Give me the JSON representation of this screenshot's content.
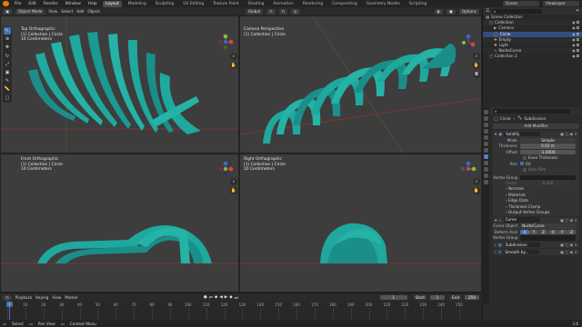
{
  "topbar": {
    "menus": [
      "File",
      "Edit",
      "Render",
      "Window",
      "Help"
    ],
    "tabs": [
      "Layout",
      "Modeling",
      "Sculpting",
      "UV Editing",
      "Texture Paint",
      "Shading",
      "Animation",
      "Rendering",
      "Compositing",
      "Geometry Nodes",
      "Scripting"
    ],
    "active_tab": "Layout",
    "scene": "Scene",
    "view_layer": "ViewLayer"
  },
  "viewport_header": {
    "mode": "Object Mode",
    "menus": [
      "View",
      "Select",
      "Add",
      "Object"
    ],
    "orientation": "Global",
    "options": "Options"
  },
  "viewports": [
    {
      "view": "Top Orthographic",
      "collection": "(1) Collection | Circle",
      "scale": "10 Centimeters"
    },
    {
      "view": "Camera Perspective",
      "collection": "(1) Collection | Circle",
      "scale": ""
    },
    {
      "view": "Front Orthographic",
      "collection": "(1) Collection | Circle",
      "scale": "10 Centimeters"
    },
    {
      "view": "Right Orthographic",
      "collection": "(1) Collection | Circle",
      "scale": "10 Centimeters"
    }
  ],
  "outliner": {
    "header": "Scene Collection",
    "items": [
      {
        "label": "Collection",
        "indent": 1
      },
      {
        "label": "Camera",
        "indent": 2
      },
      {
        "label": "Circle",
        "indent": 2,
        "selected": true
      },
      {
        "label": "Empty",
        "indent": 2
      },
      {
        "label": "Light",
        "indent": 2
      },
      {
        "label": "NurbsCurve",
        "indent": 2
      },
      {
        "label": "Collection 2",
        "indent": 1
      }
    ]
  },
  "properties": {
    "breadcrumb_obj": "Circle",
    "breadcrumb_mod": "Subdivision",
    "add_modifier": "Add Modifier",
    "solidify": {
      "name": "Solidify",
      "mode_label": "Mode",
      "mode": "Simple",
      "thickness_label": "Thickness",
      "thickness": "0.03 m",
      "offset_label": "Offset",
      "offset": "-1.0000",
      "even_thickness": "Even Thickness",
      "rim_label": "Rim",
      "fill": "Fill",
      "only_rim": "Only Rim",
      "vertex_group_label": "Vertex Group",
      "factor_label": "Factor",
      "factor": "0.000",
      "subpanels": [
        "Normals",
        "Materials",
        "Edge Data",
        "Thickness Clamp",
        "Output Vertex Groups"
      ]
    },
    "curve": {
      "name": "Curve",
      "curve_object_label": "Curve Object",
      "curve_object": "NurbsCurve",
      "deform_axis_label": "Deform Axis",
      "axes": [
        "X",
        "Y",
        "Z",
        "-X",
        "-Y",
        "-Z"
      ],
      "vertex_group_label": "Vertex Group"
    },
    "subdivision": {
      "name": "Subdivision"
    },
    "smooth": {
      "name": "Smooth by..."
    }
  },
  "timeline": {
    "menus": [
      "Playback",
      "Keying",
      "View",
      "Marker"
    ],
    "current_frame": "1",
    "start_label": "Start",
    "start": "1",
    "end_label": "End",
    "end": "250",
    "ticks": [
      "0",
      "10",
      "20",
      "30",
      "40",
      "50",
      "60",
      "70",
      "80",
      "90",
      "100",
      "110",
      "120",
      "130",
      "140",
      "150",
      "160",
      "170",
      "180",
      "190",
      "200",
      "210",
      "220",
      "230",
      "240",
      "250"
    ]
  },
  "status": {
    "items": [
      "Select",
      "Pan View",
      "Context Menu"
    ],
    "version": "3.6"
  },
  "colors": {
    "accent": "#4772b3",
    "teal": "#1fa89e",
    "teal_dark": "#0f6f68",
    "x_axis": "#a33535",
    "y_axis": "#6d8c2a"
  }
}
